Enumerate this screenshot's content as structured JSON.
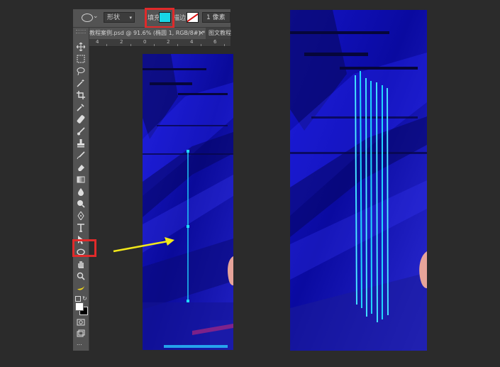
{
  "options_bar": {
    "mode": "形状",
    "fill_label": "填充:",
    "fill_color": "#18d6e6",
    "stroke_label": "描边:",
    "stroke_width": "1 像素"
  },
  "tabs": {
    "active": "教程案例.psd @ 91.6% (椭圆 1, RGB/8#) *",
    "close": "×",
    "second": "图文教程"
  },
  "ruler": [
    "4",
    "2",
    "0",
    "2",
    "4",
    "6"
  ],
  "toolbar": {
    "tools": [
      "move-icon",
      "marquee-icon",
      "lasso-icon",
      "magic-wand-icon",
      "crop-icon",
      "eyedropper-icon",
      "healing-brush-icon",
      "brush-icon",
      "clone-stamp-icon",
      "history-brush-icon",
      "eraser-icon",
      "gradient-icon",
      "blur-icon",
      "dodge-icon",
      "pen-icon",
      "type-icon",
      "path-selection-icon",
      "ellipse-tool-icon",
      "hand-icon",
      "zoom-icon",
      "banana-icon"
    ],
    "edit_toolbar": "..."
  },
  "colors": {
    "highlight": "#e02a2a",
    "arrow": "#f2e81a",
    "glow_line": "#1fd8ff"
  }
}
